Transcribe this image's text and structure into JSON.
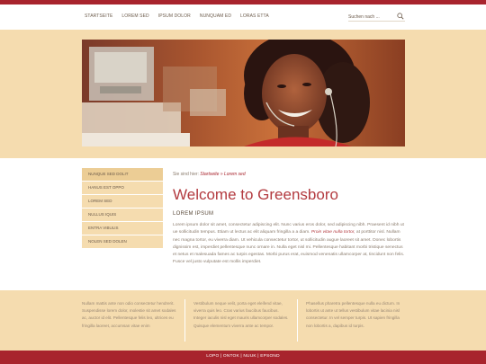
{
  "nav": {
    "items": [
      "STARTSEITE",
      "LOREM SED",
      "IPSUM DOLOR",
      "NUNQUAM ED",
      "LORAS ETTA"
    ]
  },
  "search": {
    "placeholder": "Suchen nach ..."
  },
  "sidebar": {
    "items": [
      "NUNQUE SED DOLIT",
      "HANUS EST OPPO",
      "LOREM SED",
      "NULLUS IQUIS",
      "ENTRA VIBULIS",
      "NOLEN SED DOLEN"
    ]
  },
  "breadcrumb": {
    "prefix": "Sie sind hier:",
    "home": "Startseite",
    "separator": "»",
    "current": "Lorem sed"
  },
  "main": {
    "title": "Welcome to Greensboro",
    "subhead": "LOREM IPSUM",
    "para_a": "Lorem ipsum dolor sit amet, consectetur adipiscing elit. Nunc varius eros dolor, sed adipiscing nibh. Praesent id nibh ut ue sollicitudin tempus. Etiam ut lectus ac elit aliquam fringilla a a diam. ",
    "para_highlight": "Proin vitae nulla tortor,",
    "para_b": " at porttitor nisl. Nullam nec magna tortor, eu viverra diam. Ut vehicula consectetur tortor, ut sollicitudin augue laoreet sit amet. Donec lobortis dignissim est, imperdiet pellentesque nunc ornare in. Nulla eget nisl mi. Pellentesque habitant morbi tristique senectus et netus et malesuada fames ac turpis egestas. Morbi purus erat, euismod venenatis ullamcorper at, tincidunt non felis. Fusce vel justo vulputate est mollis imperdiet."
  },
  "footer": {
    "col1": "Nullam mattis ante non odio consectetur hendrerit. Suspendisse lorem dolor, molestie sit amet sodales ac, auctor id elit. Pellentesque felis leo, ultrices eu fringilla laoreet, accumsan vitae enim",
    "col2": "Vestibulum neque velit, porta eget eleifend vitae, viverra quis leo. Cras varius faucibus faucibus. Integer iaculis nisl eget mauris ullamcorper sodales. Quisque elementum viverra ante ac tempor.",
    "col3": "Phasellus pharetra pellentesque nulla eu dictum. In lobortis ut ante ut tellus vestibulum vitae lacinia nisl consectetur. In vel semper turpis. Ut sapien fringilla non lobortis a, dapibus id turpis."
  },
  "bottom": {
    "links": "LOPO | ONTOK | NUUK | EPSOND"
  },
  "colors": {
    "accent": "#a8242d",
    "band": "#f5dcaf",
    "title": "#b33a3f"
  },
  "icons": {
    "search": "search-icon"
  }
}
